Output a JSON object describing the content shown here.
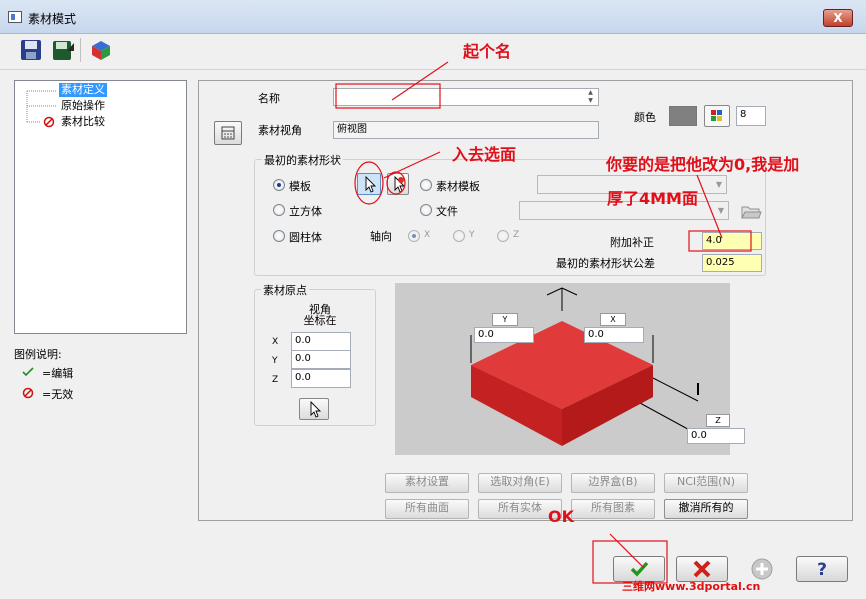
{
  "window": {
    "title": "素材模式",
    "close_label": "X"
  },
  "tree": {
    "items": [
      {
        "label": "素材定义"
      },
      {
        "label": "原始操作"
      },
      {
        "label": "素材比较"
      }
    ]
  },
  "legend": {
    "title": "图例说明:",
    "edit": "=编辑",
    "invalid": "=无效"
  },
  "main": {
    "name_label": "名称",
    "name_value": "",
    "color_label": "颜色",
    "color_value": "8",
    "color_swatch": "#808080",
    "view_label": "素材视角",
    "view_value": "俯视图",
    "shape_group": "最初的素材形状",
    "shapes": {
      "template": "模板",
      "cube": "立方体",
      "cylinder": "圆柱体",
      "stock_template": "素材模板",
      "file": "文件"
    },
    "axis_label": "轴向",
    "axes": [
      "X",
      "Y",
      "Z"
    ],
    "offset_label": "附加补正",
    "offset_value": "4.0",
    "tolerance_label": "最初的素材形状公差",
    "tolerance_value": "0.025",
    "origin_group": "素材原点",
    "origin_view_line1": "视角",
    "origin_view_line2": "坐标在",
    "origin": [
      {
        "axis": "X",
        "value": "0.0"
      },
      {
        "axis": "Y",
        "value": "0.0"
      },
      {
        "axis": "Z",
        "value": "0.0"
      }
    ],
    "preview": {
      "y_label": "Y",
      "y_value": "0.0",
      "x_label": "X",
      "x_value": "0.0",
      "z_label": "Z",
      "z_value": "0.0"
    },
    "buttons_row1": [
      "素材设置",
      "选取对角(E)",
      "边界盒(B)",
      "NCI范围(N)"
    ],
    "buttons_row2": [
      "所有曲面",
      "所有实体",
      "所有图素",
      "撤消所有的"
    ]
  },
  "annotations": {
    "name_note": "起个名",
    "select_note": "入去选面",
    "offset_note_line1": "你要的是把他改为0,我是加",
    "offset_note_line2": "厚了4MM面",
    "ok_note": "OK"
  },
  "watermark": "三维网www.3dportal.cn",
  "colors": {
    "annotation_red": "#e0101a",
    "stock_red": "#d42020",
    "selection_blue": "#3399ff"
  }
}
